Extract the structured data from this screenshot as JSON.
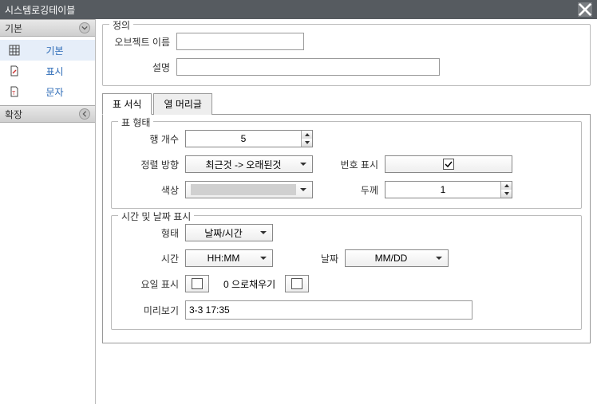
{
  "window": {
    "title": "시스템로깅테이블"
  },
  "sidebar": {
    "sections": [
      {
        "title": "기본",
        "items": [
          {
            "label": "기본"
          },
          {
            "label": "표시"
          },
          {
            "label": "문자"
          }
        ]
      },
      {
        "title": "확장",
        "items": []
      }
    ]
  },
  "definition": {
    "legend": "정의",
    "object_name_label": "오브젝트 이름",
    "object_name_value": "",
    "description_label": "설명",
    "description_value": ""
  },
  "tabs": {
    "format": "표 서식",
    "header": "열 머리글"
  },
  "table_form": {
    "legend": "표 형태",
    "row_count_label": "행 개수",
    "row_count_value": "5",
    "sort_label": "정렬 방향",
    "sort_value": "최근것 -> 오래된것",
    "show_number_label": "번호 표시",
    "show_number_checked": true,
    "color_label": "색상",
    "thickness_label": "두께",
    "thickness_value": "1"
  },
  "datetime": {
    "legend": "시간 및 날짜 표시",
    "form_label": "형태",
    "form_value": "날짜/시간",
    "time_label": "시간",
    "time_value": "HH:MM",
    "date_label": "날짜",
    "date_value": "MM/DD",
    "weekday_label": "요일 표시",
    "weekday_checked": false,
    "zerofill_label": "0 으로채우기",
    "zerofill_checked": false,
    "preview_label": "미리보기",
    "preview_value": "3-3 17:35"
  }
}
